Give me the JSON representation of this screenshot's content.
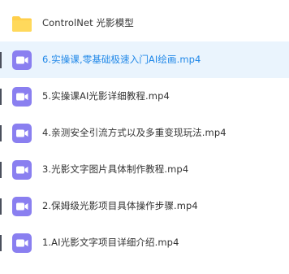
{
  "colors": {
    "selected_bg": "#eaf4fd",
    "selected_text": "#1f87e8",
    "video_icon": "#8a7ff0",
    "folder_icon": "#ffcf4b"
  },
  "files": [
    {
      "name": "ControlNet 光影模型",
      "type": "folder",
      "icon": "folder-icon",
      "selected": false
    },
    {
      "name": "6.实操课,零基础极速入门AI绘画.mp4",
      "type": "video",
      "icon": "video-file-icon",
      "selected": true
    },
    {
      "name": "5.实操课AI光影详细教程.mp4",
      "type": "video",
      "icon": "video-file-icon",
      "selected": false
    },
    {
      "name": "4.亲测安全引流方式以及多重变现玩法.mp4",
      "type": "video",
      "icon": "video-file-icon",
      "selected": false
    },
    {
      "name": "3.光影文字图片具体制作教程.mp4",
      "type": "video",
      "icon": "video-file-icon",
      "selected": false
    },
    {
      "name": "2.保姆级光影项目具体操作步骤.mp4",
      "type": "video",
      "icon": "video-file-icon",
      "selected": false
    },
    {
      "name": "1.AI光影文字项目详细介绍.mp4",
      "type": "video",
      "icon": "video-file-icon",
      "selected": false
    }
  ]
}
